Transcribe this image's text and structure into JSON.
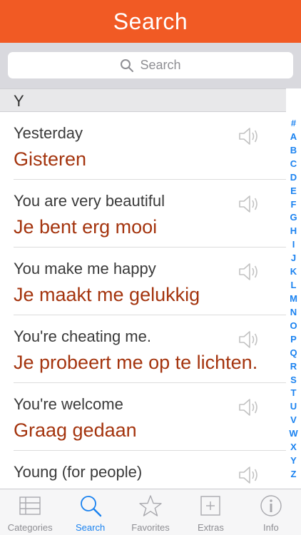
{
  "header": {
    "title": "Search"
  },
  "search": {
    "placeholder": "Search"
  },
  "section": {
    "letter": "Y"
  },
  "phrases": [
    {
      "english": "Yesterday",
      "dutch": "Gisteren"
    },
    {
      "english": "You are very beautiful",
      "dutch": "Je bent erg mooi"
    },
    {
      "english": "You make me happy",
      "dutch": "Je maakt me gelukkig"
    },
    {
      "english": "You're cheating me.",
      "dutch": "Je probeert me op te lichten."
    },
    {
      "english": "You're welcome",
      "dutch": "Graag gedaan"
    },
    {
      "english": "Young (for people)",
      "dutch": ""
    }
  ],
  "index_letters": [
    "#",
    "A",
    "B",
    "C",
    "D",
    "E",
    "F",
    "G",
    "H",
    "I",
    "J",
    "K",
    "L",
    "M",
    "N",
    "O",
    "P",
    "Q",
    "R",
    "S",
    "T",
    "U",
    "V",
    "W",
    "X",
    "Y",
    "Z"
  ],
  "tabs": [
    {
      "label": "Categories",
      "icon": "list-icon",
      "active": false
    },
    {
      "label": "Search",
      "icon": "search-icon",
      "active": true
    },
    {
      "label": "Favorites",
      "icon": "star-icon",
      "active": false
    },
    {
      "label": "Extras",
      "icon": "plus-box-icon",
      "active": false
    },
    {
      "label": "Info",
      "icon": "info-icon",
      "active": false
    }
  ],
  "colors": {
    "header": "#f15a24",
    "translation": "#a4340e",
    "accent": "#1a82f0"
  }
}
